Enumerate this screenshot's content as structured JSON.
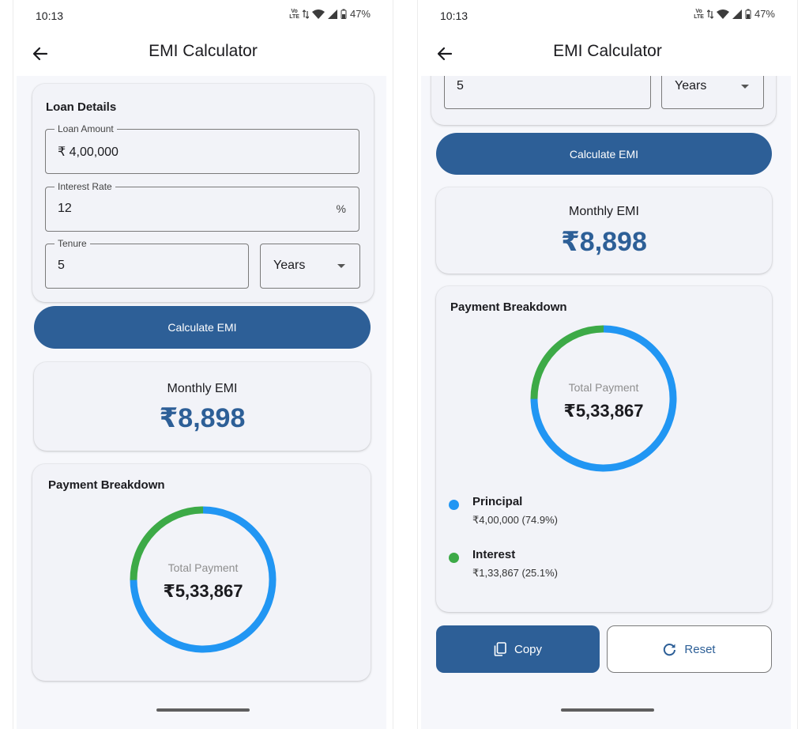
{
  "status_bar": {
    "time": "10:13",
    "network_badge_top": "Vo",
    "network_badge_bottom": "LTE",
    "battery": "47%"
  },
  "app_bar": {
    "title": "EMI Calculator",
    "back_icon": "arrow-back-icon"
  },
  "loan_details": {
    "title": "Loan Details",
    "loan_amount": {
      "label": "Loan Amount",
      "value": "₹ 4,00,000"
    },
    "interest_rate": {
      "label": "Interest Rate",
      "value": "12",
      "suffix": "%"
    },
    "tenure": {
      "label": "Tenure",
      "value": "5",
      "unit": "Years"
    }
  },
  "calculate_button": {
    "label": "Calculate EMI"
  },
  "monthly_emi": {
    "label": "Monthly EMI",
    "value": "₹8,898"
  },
  "payment_breakdown": {
    "title": "Payment Breakdown",
    "center_label": "Total Payment",
    "center_value": "₹5,33,867",
    "items": [
      {
        "name": "Principal",
        "value": "₹4,00,000 (74.9%)",
        "share": 0.749,
        "color": "#2196f3"
      },
      {
        "name": "Interest",
        "value": "₹1,33,867 (25.1%)",
        "share": 0.251,
        "color": "#3daa47"
      }
    ]
  },
  "actions": {
    "copy_label": "Copy",
    "copy_icon": "copy-icon",
    "reset_label": "Reset",
    "reset_icon": "refresh-icon"
  },
  "colors": {
    "primary": "#2d5f97",
    "principal": "#2196f3",
    "interest": "#3daa47"
  }
}
